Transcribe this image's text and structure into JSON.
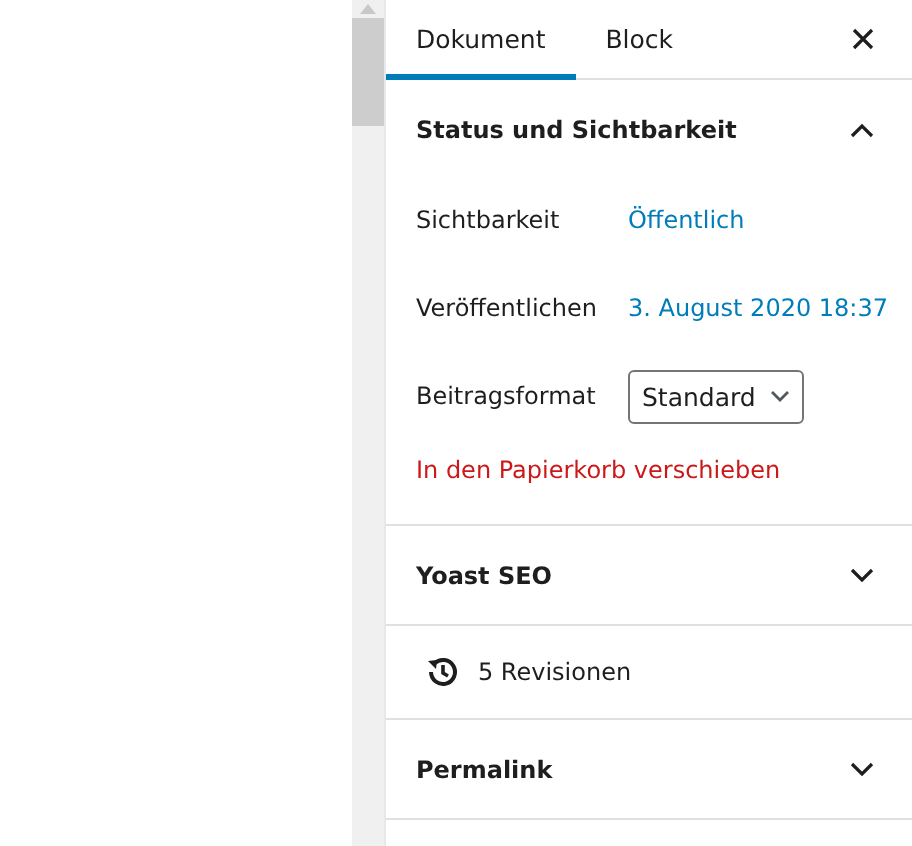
{
  "tabs": [
    {
      "label": "Dokument",
      "selected": true
    },
    {
      "label": "Block",
      "selected": false
    }
  ],
  "sections": [
    {
      "kind": "panel",
      "title": "Status und Sichtbarkeit",
      "expanded": true,
      "rows": [
        {
          "kind": "link",
          "label": "Sichtbarkeit",
          "value": "Öffentlich"
        },
        {
          "kind": "link",
          "label": "Veröffentlichen",
          "value": "3. August 2020 18:37"
        },
        {
          "kind": "select",
          "label": "Beitragsformat",
          "value": "Standard"
        }
      ],
      "action": "In den Papierkorb verschieben"
    },
    {
      "kind": "panel",
      "title": "Yoast SEO",
      "expanded": false
    },
    {
      "kind": "revisions",
      "title": "5 Revisionen"
    },
    {
      "kind": "panel",
      "title": "Permalink",
      "expanded": false
    }
  ]
}
